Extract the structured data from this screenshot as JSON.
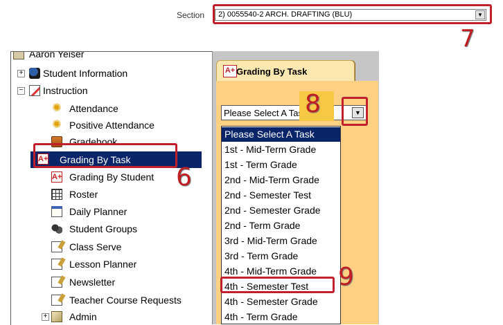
{
  "section": {
    "label": "Section",
    "value": "2) 0055540-2 ARCH. DRAFTING (BLU)"
  },
  "annotations": {
    "n6": "6",
    "n7": "7",
    "n8": "8",
    "n9": "9"
  },
  "accent_color": "#c0202c",
  "selection_color": "#0a246a",
  "tree": {
    "user": "Aaron Yeiser",
    "student_information": "Student Information",
    "instruction": "Instruction",
    "items": {
      "attendance": "Attendance",
      "positive_attendance": "Positive Attendance",
      "gradebook": "Gradebook",
      "grading_by_task": "Grading By Task",
      "grading_by_student": "Grading By Student",
      "roster": "Roster",
      "daily_planner": "Daily Planner",
      "student_groups": "Student Groups",
      "class_serve": "Class Serve",
      "lesson_planner": "Lesson Planner",
      "newsletter": "Newsletter",
      "teacher_course_requests": "Teacher Course Requests"
    },
    "admin": "Admin",
    "toggle_expand": "+",
    "toggle_collapse": "−"
  },
  "tab": {
    "icon_text": "A+",
    "label": "Grading By Task"
  },
  "task_select": {
    "value": "Please Select A Task",
    "options": [
      "Please Select A Task",
      "1st - Mid-Term Grade",
      "1st - Term Grade",
      "2nd - Mid-Term Grade",
      "2nd - Semester Test",
      "2nd - Semester Grade",
      "2nd - Term Grade",
      "3rd - Mid-Term Grade",
      "3rd - Term Grade",
      "4th - Mid-Term Grade",
      "4th - Semester Test",
      "4th - Semester Grade",
      "4th - Term Grade"
    ],
    "selected_index": 0,
    "highlighted_option": "4th - Semester Test"
  }
}
